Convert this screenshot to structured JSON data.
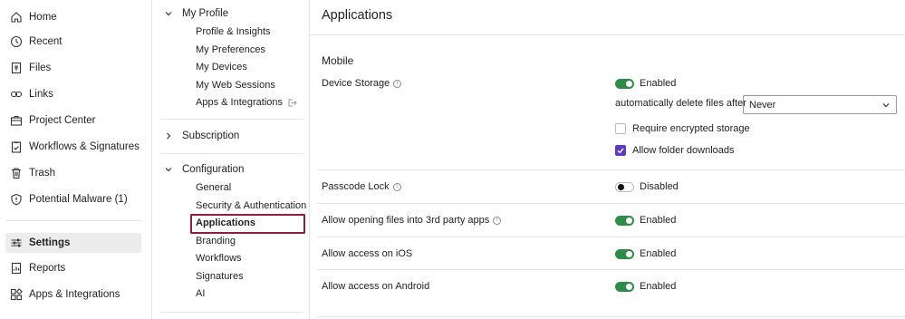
{
  "nav": {
    "items": [
      {
        "label": "Home",
        "icon": "home-icon"
      },
      {
        "label": "Recent",
        "icon": "clock-icon"
      },
      {
        "label": "Files",
        "icon": "files-icon"
      },
      {
        "label": "Links",
        "icon": "link-icon"
      },
      {
        "label": "Project Center",
        "icon": "briefcase-icon"
      },
      {
        "label": "Workflows & Signatures",
        "icon": "clipboard-check-icon"
      },
      {
        "label": "Trash",
        "icon": "trash-icon"
      },
      {
        "label": "Potential Malware (1)",
        "icon": "shield-alert-icon"
      }
    ],
    "bottom": [
      {
        "label": "Settings",
        "icon": "sliders-icon",
        "active": true
      },
      {
        "label": "Reports",
        "icon": "report-icon"
      },
      {
        "label": "Apps & Integrations",
        "icon": "apps-icon"
      }
    ]
  },
  "tree": {
    "my_profile": {
      "label": "My Profile",
      "items": [
        "Profile & Insights",
        "My Preferences",
        "My Devices",
        "My Web Sessions",
        "Apps & Integrations"
      ]
    },
    "subscription": {
      "label": "Subscription"
    },
    "configuration": {
      "label": "Configuration",
      "items": [
        "General",
        "Security & Authentication",
        "Applications",
        "Branding",
        "Workflows",
        "Signatures",
        "AI"
      ]
    }
  },
  "main": {
    "title": "Applications",
    "section": "Mobile",
    "device_storage": {
      "label": "Device Storage",
      "status": "Enabled",
      "auto_delete_label": "automatically delete files after",
      "auto_delete_value": "Never",
      "require_encrypted": "Require encrypted storage",
      "allow_downloads": "Allow folder downloads"
    },
    "passcode": {
      "label": "Passcode Lock",
      "status": "Disabled"
    },
    "third_party": {
      "label": "Allow opening files into 3rd party apps",
      "status": "Enabled"
    },
    "ios": {
      "label": "Allow access on iOS",
      "status": "Enabled"
    },
    "android": {
      "label": "Allow access on Android",
      "status": "Enabled"
    }
  },
  "colors": {
    "toggle_on": "#2e8b48",
    "checkbox": "#5f3bbf",
    "selection": "#8f1f3e"
  }
}
